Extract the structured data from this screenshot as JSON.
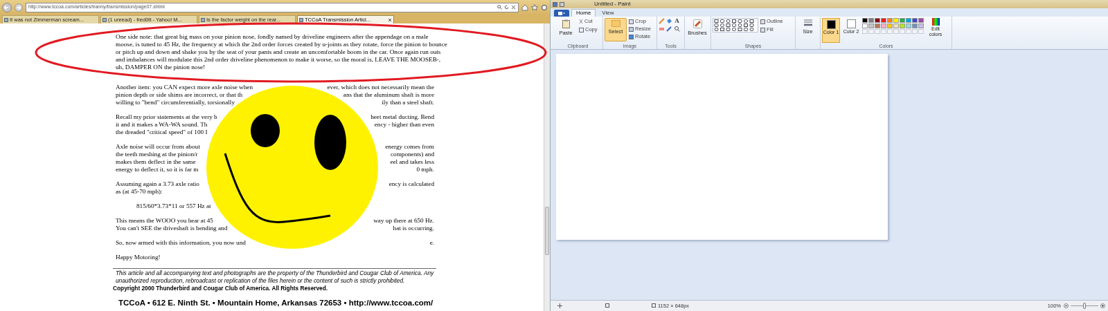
{
  "browser": {
    "address": "http://www.tccoa.com/articles/tranny/transmission/page07.shtml",
    "tabs": [
      {
        "label": "It was not Zimmerman scream...",
        "selected": false
      },
      {
        "label": "(1 unread) - fred0tt - Yahoo! M...",
        "selected": false
      },
      {
        "label": "Is the factor weight on the rear...",
        "selected": false
      },
      {
        "label": "TCCoA Transmission Articl...",
        "selected": true
      }
    ],
    "article": {
      "paragraphs": [
        {
          "kind": "text",
          "lines": [
            {
              "left": "One side note:  that great big mass on your pinion nose, fondly named by driveline engineers after the appendage on a male"
            },
            {
              "left": "moose, is tuned to 45 Hz, the frequency at which the 2nd order forces created by u-joints as they rotate, force the pinion to bounce"
            },
            {
              "left": "or pitch up and down and shake you by the seat of your pants and create an uncomfortable boom in the car.  Once again run outs"
            },
            {
              "left": "and imbalances will modulate this 2nd order driveline phenomenon to make it worse, so the moral is, LEAVE THE MOOSEB-,"
            },
            {
              "left": "uh, DAMPER ON the pinion nose!"
            }
          ]
        },
        {
          "kind": "text",
          "lines": [
            {
              "left": "Another item: you CAN expect more axle noise when",
              "right": "ever, which does not necessarily mean the"
            },
            {
              "left": "pinion depth or side shims are incorrect, or that th",
              "right": "ans that the aluminum shaft is more"
            },
            {
              "left": "willing to \"bend\" circumferentially, torsionally",
              "right": "ily than a steel shaft."
            }
          ]
        },
        {
          "kind": "text",
          "lines": [
            {
              "left": "Recall my prior statements at the very b",
              "right": "heet metal ducting.  Bend"
            },
            {
              "left": "it and it makes a WA-WA sound.  Th",
              "right": "ency - higher than even"
            },
            {
              "left": "the dreaded \"critical speed\" of 100 I"
            }
          ]
        },
        {
          "kind": "text",
          "lines": [
            {
              "left": "Axle noise will occur from about",
              "right": "energy comes from"
            },
            {
              "left": "the teeth meshing at the pinion/r",
              "right": "components) and"
            },
            {
              "left": "makes them deflect in the same",
              "right": "eel and takes less"
            },
            {
              "left": "energy to deflect it, so it is far m",
              "right": "0 mph."
            }
          ]
        },
        {
          "kind": "text",
          "lines": [
            {
              "left": "Assuming again a 3.73 axle ratio",
              "right": "ency is calculated"
            },
            {
              "left": "as (at 45-70 mph):"
            }
          ]
        },
        {
          "kind": "formula",
          "lines": [
            {
              "left": "815/60*3.73*11 or 557 Hz at"
            }
          ]
        },
        {
          "kind": "text",
          "lines": [
            {
              "left": "This means the WOOO you hear at 45",
              "right": "way up there at 650 Hz."
            },
            {
              "left": "You can't SEE the driveshaft is bending and",
              "right": "hat is occurring."
            }
          ]
        },
        {
          "kind": "text",
          "lines": [
            {
              "left": "So, now armed with this information, you now und",
              "right": "e."
            }
          ]
        },
        {
          "kind": "text",
          "lines": [
            {
              "left": "Happy Motoring!"
            }
          ]
        }
      ],
      "notice": [
        "This article and all accompanying text and photographs are the property of the Thunderbird and Cougar Club of America.  Any",
        "unauthorized reproduction, rebroadcast or replication of the files herein or the content of such is strictly prohibited."
      ],
      "copyright": "Copyright 2000 Thunderbird and Cougar Club of America.  All Rights Reserved.",
      "contact": "TCCoA • 612 E. Ninth St. • Mountain Home, Arkansas  72653 • http://www.tccoa.com/"
    }
  },
  "paint": {
    "title": "Untitled - Paint",
    "tabs": [
      {
        "label": "Home",
        "selected": true
      },
      {
        "label": "View",
        "selected": false
      }
    ],
    "clipboard": {
      "paste": "Paste",
      "cut": "Cut",
      "copy": "Copy",
      "label": "Clipboard"
    },
    "image": {
      "select": "Select",
      "crop": "Crop",
      "resize": "Resize",
      "rotate": "Rotate",
      "label": "Image"
    },
    "tools_label": "Tools",
    "text_tool": "A",
    "brushes": "Brushes",
    "shapes_label": "Shapes",
    "outline": "Outline",
    "fill": "Fill",
    "size": "Size",
    "color1": {
      "label": "Color 1",
      "color": "#000000",
      "selected": true
    },
    "color2": {
      "label": "Color 2",
      "color": "#ffffff",
      "selected": false
    },
    "palette": [
      {
        "color": "#000000"
      },
      {
        "color": "#7f7f7f"
      },
      {
        "color": "#880015"
      },
      {
        "color": "#ed1c24"
      },
      {
        "color": "#ff7f27"
      },
      {
        "color": "#fff200"
      },
      {
        "color": "#22b14c"
      },
      {
        "color": "#00a2e8"
      },
      {
        "color": "#3f48cc"
      },
      {
        "color": "#a349a4"
      },
      {
        "color": "#ffffff"
      },
      {
        "color": "#c3c3c3"
      },
      {
        "color": "#b97a57"
      },
      {
        "color": "#ffaec9"
      },
      {
        "color": "#ffc90e"
      },
      {
        "color": "#efe4b0"
      },
      {
        "color": "#b5e61d"
      },
      {
        "color": "#99d9ea"
      },
      {
        "color": "#7092be"
      },
      {
        "color": "#c8bfe7"
      }
    ],
    "colors_label": "Colors",
    "edit_colors": "Edit colors",
    "status": {
      "dimensions": "1152 × 648px",
      "zoom": "100%",
      "zoom_slider": {
        "level": 0.5
      }
    }
  }
}
